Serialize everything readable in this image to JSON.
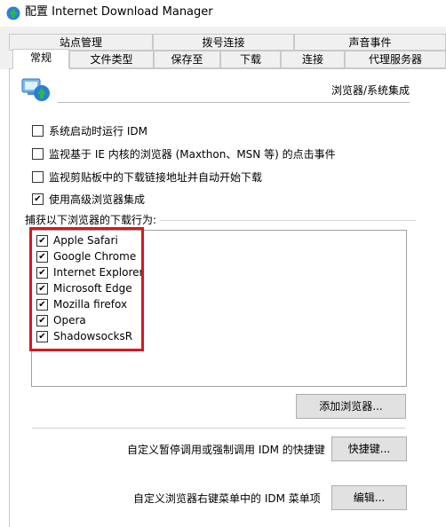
{
  "window": {
    "title": "配置 Internet Download Manager"
  },
  "tabs": {
    "row1": [
      "站点管理",
      "拨号连接",
      "声音事件"
    ],
    "row2": [
      "常规",
      "文件类型",
      "保存至",
      "下载",
      "连接",
      "代理服务器"
    ],
    "active": "常规"
  },
  "section": {
    "title": "浏览器/系统集成"
  },
  "options": [
    {
      "label": "系统启动时运行 IDM",
      "checked": false
    },
    {
      "label": "监视基于 IE 内核的浏览器 (Maxthon、MSN 等) 的点击事件",
      "checked": false
    },
    {
      "label": "监视剪贴板中的下载链接地址并自动开始下载",
      "checked": false
    },
    {
      "label": "使用高级浏览器集成",
      "checked": true
    }
  ],
  "browsers": {
    "group_label": "捕获以下浏览器的下载行为:",
    "items": [
      {
        "label": "Apple Safari",
        "checked": true
      },
      {
        "label": "Google Chrome",
        "checked": true
      },
      {
        "label": "Internet Explorer",
        "checked": true
      },
      {
        "label": "Microsoft Edge",
        "checked": true
      },
      {
        "label": "Mozilla firefox",
        "checked": true
      },
      {
        "label": "Opera",
        "checked": true
      },
      {
        "label": "ShadowsocksR",
        "checked": true
      }
    ],
    "add_button": "添加浏览器..."
  },
  "shortcut": {
    "label": "自定义暂停调用或强制调用 IDM 的快捷键",
    "button": "快捷键..."
  },
  "context_menu": {
    "label": "自定义浏览器右键菜单中的 IDM 菜单项",
    "button": "编辑..."
  },
  "colors": {
    "highlight": "#d7171f",
    "tab_bg": "#f0f0f0",
    "button_bg": "#e1e1e1"
  }
}
